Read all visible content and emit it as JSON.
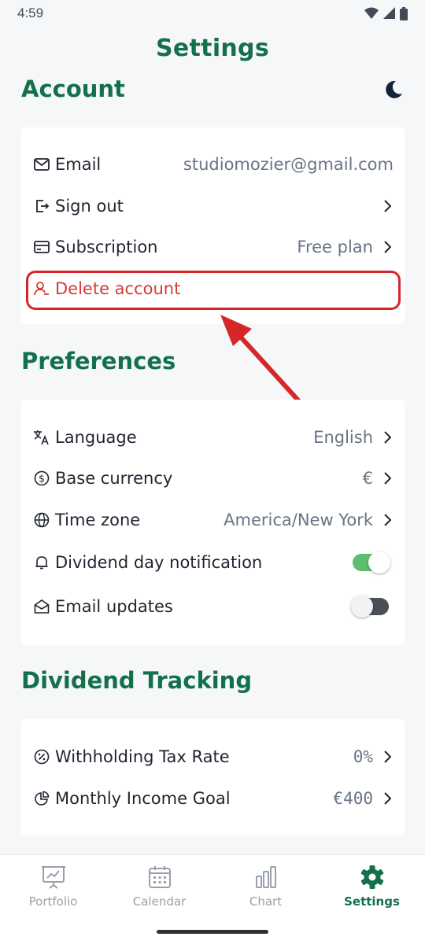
{
  "status_bar": {
    "time": "4:59"
  },
  "page_title": "Settings",
  "account": {
    "title": "Account",
    "email": {
      "label": "Email",
      "value": "studiomozier@gmail.com"
    },
    "sign_out": {
      "label": "Sign out"
    },
    "subscription": {
      "label": "Subscription",
      "value": "Free plan"
    },
    "delete_account": {
      "label": "Delete account"
    }
  },
  "preferences": {
    "title": "Preferences",
    "language": {
      "label": "Language",
      "value": "English"
    },
    "base_currency": {
      "label": "Base currency",
      "value": "€"
    },
    "time_zone": {
      "label": "Time zone",
      "value": "America/New York"
    },
    "dividend_notification": {
      "label": "Dividend day notification",
      "enabled": true
    },
    "email_updates": {
      "label": "Email updates",
      "enabled": false
    }
  },
  "dividend_tracking": {
    "title": "Dividend Tracking",
    "withholding_tax": {
      "label": "Withholding Tax Rate",
      "value": "0%"
    },
    "monthly_goal": {
      "label": "Monthly Income Goal",
      "value": "€400"
    }
  },
  "bottom_nav": {
    "items": [
      {
        "label": "Portfolio",
        "icon": "chart-presentation-icon"
      },
      {
        "label": "Calendar",
        "icon": "calendar-icon"
      },
      {
        "label": "Chart",
        "icon": "bar-chart-icon"
      },
      {
        "label": "Settings",
        "icon": "gear-icon",
        "active": true
      }
    ]
  },
  "colors": {
    "accent": "#14704b",
    "danger": "#d43a3a",
    "annotation": "#d6262a",
    "toggle_on": "#5bbf6f"
  }
}
